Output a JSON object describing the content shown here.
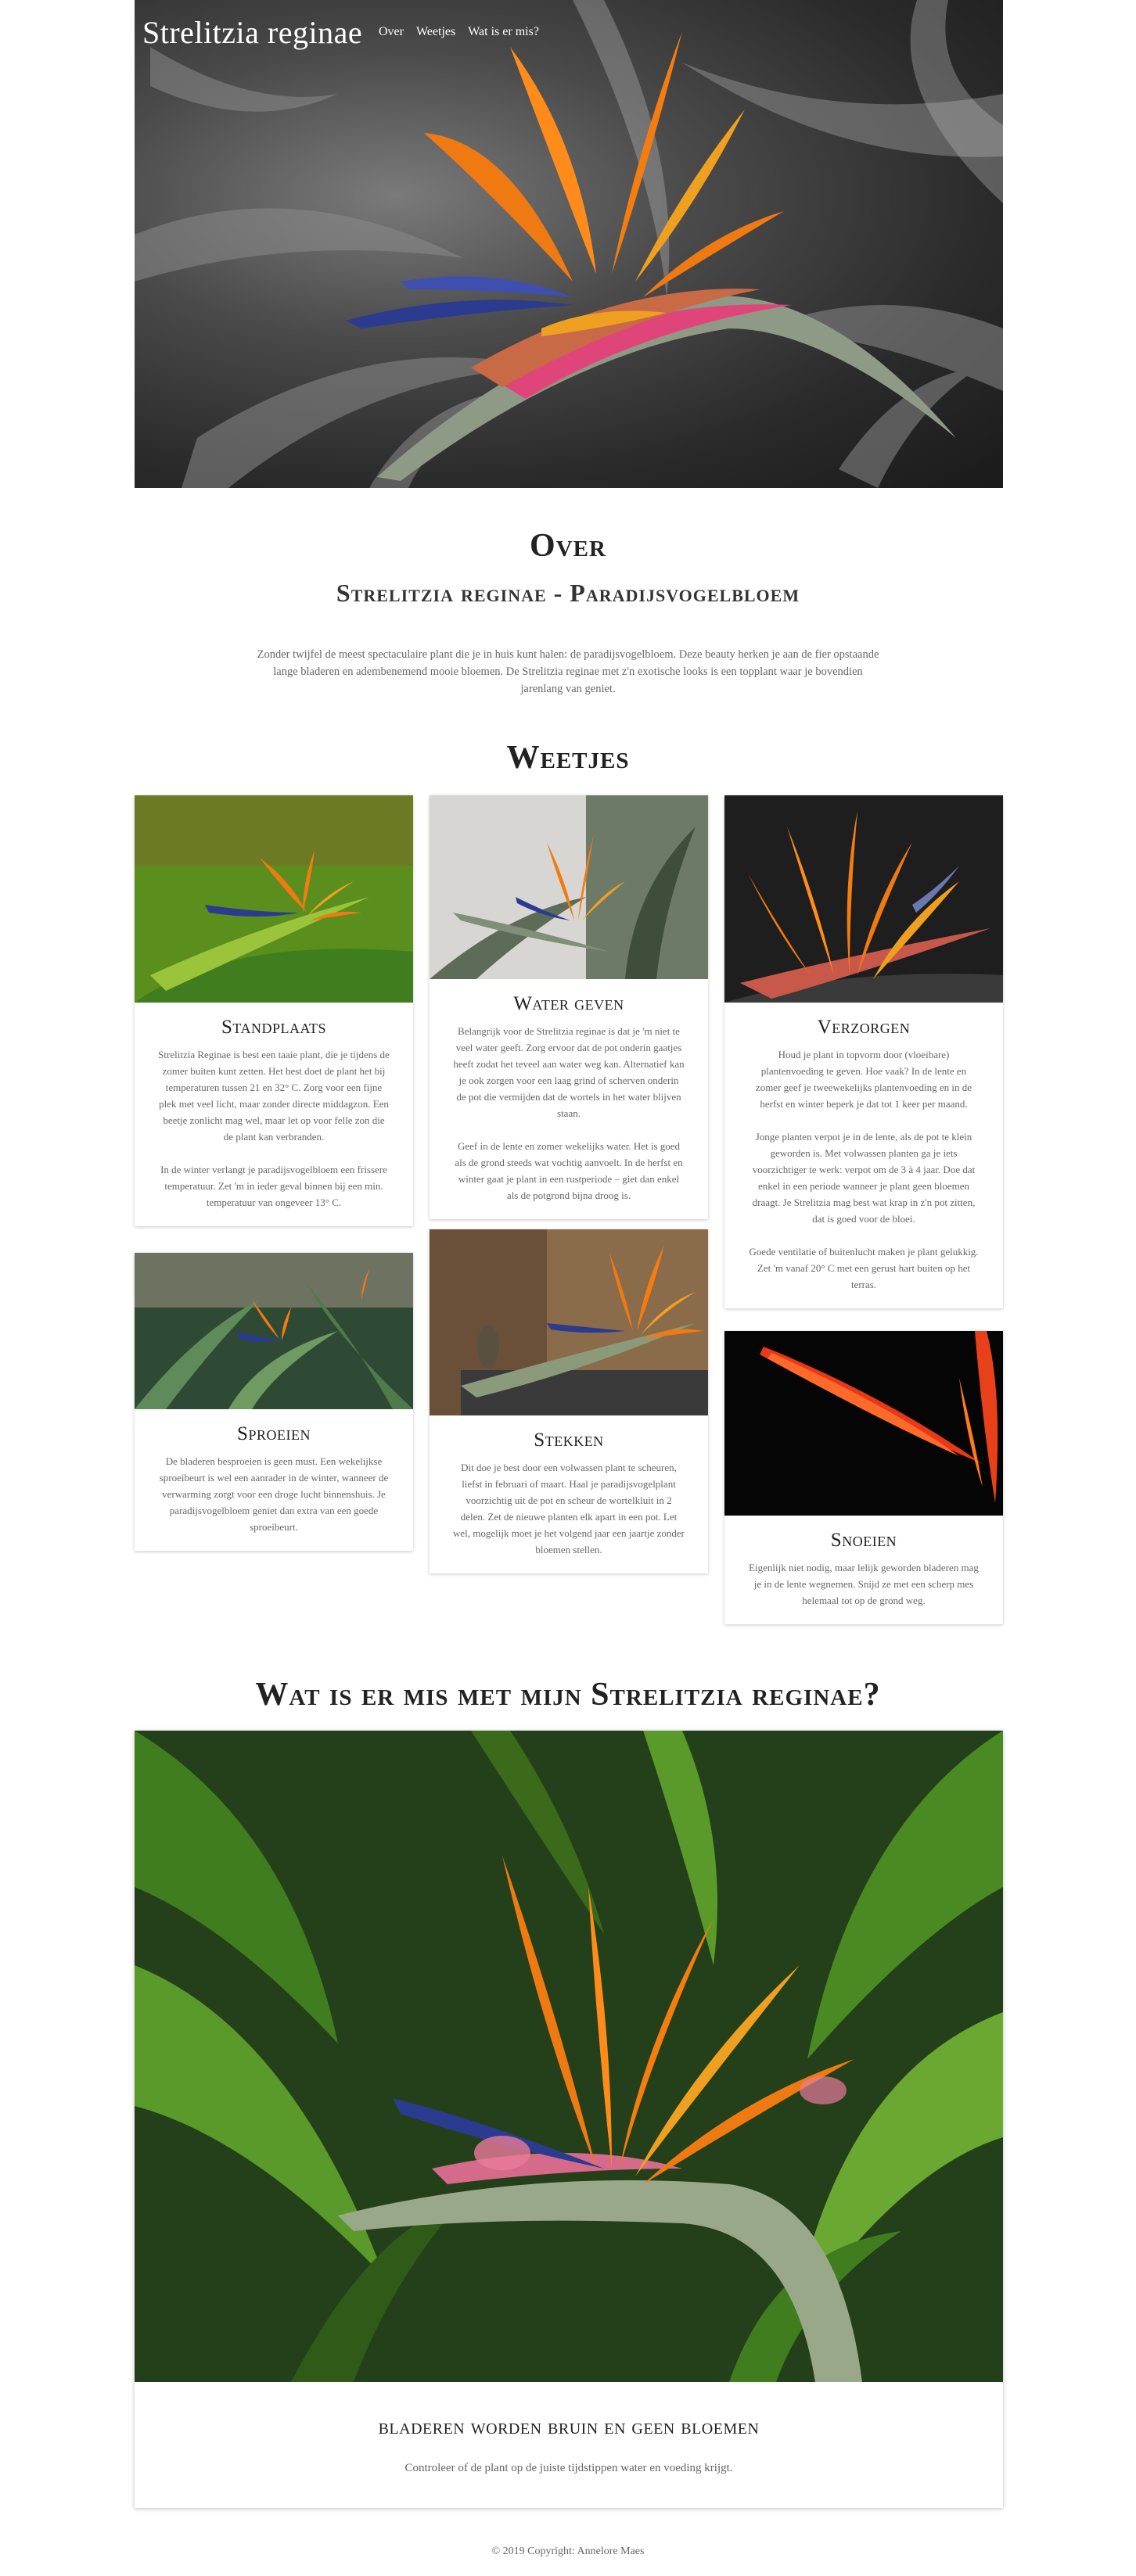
{
  "header": {
    "site_title": "Strelitzia reginae",
    "nav": [
      "Over",
      "Weetjes",
      "Wat is er mis?"
    ]
  },
  "over": {
    "title": "Over",
    "subtitle": "Strelitzia reginae - Paradijsvogelbloem",
    "text": "Zonder twijfel de meest spectaculaire plant die je in huis kunt halen: de paradijsvogelbloem. Deze beauty herken je aan de fier opstaande lange bladeren en adembenemend mooie bloemen. De Strelitzia reginae met z'n exotische looks is een topplant waar je bovendien jarenlang van geniet."
  },
  "weetjes": {
    "title": "Weetjes",
    "cards": [
      {
        "title": "Standplaats",
        "paragraphs": [
          "Strelitzia Reginae is best een taaie plant, die je tijdens de zomer buiten kunt zetten. Het best doet de plant het bij temperaturen tussen 21 en 32° C. Zorg voor een fijne plek met veel licht, maar zonder directe middagzon. Een beetje zonlicht mag wel, maar let op voor felle zon die de plant kan verbranden.",
          "In de winter verlangt je paradijsvogelbloem een frissere temperatuur. Zet 'm in ieder geval binnen bij een min. temperatuur van ongeveer 13° C."
        ]
      },
      {
        "title": "Water geven",
        "paragraphs": [
          "Belangrijk voor de Strelitzia reginae is dat je 'm niet te veel water geeft. Zorg ervoor dat de pot onderin gaatjes heeft zodat het teveel aan water weg kan. Alternatief kan je ook zorgen voor een laag grind of scherven onderin de pot die vermijden dat de wortels in het water blijven staan.",
          "Geef in de lente en zomer wekelijks water. Het is goed als de grond steeds wat vochtig aanvoelt. In de herfst en winter gaat je plant in een rustperiode – giet dan enkel als de potgrond bijna droog is."
        ]
      },
      {
        "title": "Verzorgen",
        "paragraphs": [
          "Houd je plant in topvorm door (vloeibare) plantenvoeding te geven. Hoe vaak? In de lente en zomer geef je tweewekelijks plantenvoeding en in de herfst en winter beperk je dat tot 1 keer per maand.",
          "Jonge planten verpot je in de lente, als de pot te klein geworden is. Met volwassen planten ga je iets voorzichtiger te werk: verpot om de 3 à 4 jaar. Doe dat enkel in een periode wanneer je plant geen bloemen draagt. Je Strelitzia mag best wat krap in z'n pot zitten, dat is goed voor de bloei.",
          "Goede ventilatie of buitenlucht maken je plant gelukkig. Zet 'm vanaf 20° C met een gerust hart buiten op het terras."
        ]
      },
      {
        "title": "Sproeien",
        "paragraphs": [
          "De bladeren besproeien is geen must. Een wekelijkse sproeibeurt is wel een aanrader in de winter, wanneer de verwarming zorgt voor een droge lucht binnenshuis. Je paradijsvogelbloem geniet dan extra van een goede sproeibeurt."
        ]
      },
      {
        "title": "Stekken",
        "paragraphs": [
          "Dit doe je best door een volwassen plant te scheuren, liefst in februari of maart. Haal je paradijsvogelplant voorzichtig uit de pot en scheur de wortelkluit in 2 delen. Zet de nieuwe planten elk apart in een pot. Let wel, mogelijk moet je het volgend jaar een jaartje zonder bloemen stellen."
        ]
      },
      {
        "title": "Snoeien",
        "paragraphs": [
          "Eigenlijk niet nodig, maar lelijk geworden bladeren mag je in de lente wegnemen. Snijd ze met een scherp mes helemaal tot op de grond weg."
        ]
      }
    ]
  },
  "mis": {
    "title": "Wat is er mis met mijn Strelitzia reginae?",
    "card_title": "bladeren worden bruin en geen bloemen",
    "card_text": "Controleer of de plant op de juiste tijdstippen water en voeding krijgt."
  },
  "footer": {
    "text": "© 2019 Copyright: Annelore Maes"
  },
  "colors": {
    "orange": "#f07a12",
    "blue": "#2b3b8f",
    "green": "#3f7d1e",
    "dark": "#222222"
  }
}
